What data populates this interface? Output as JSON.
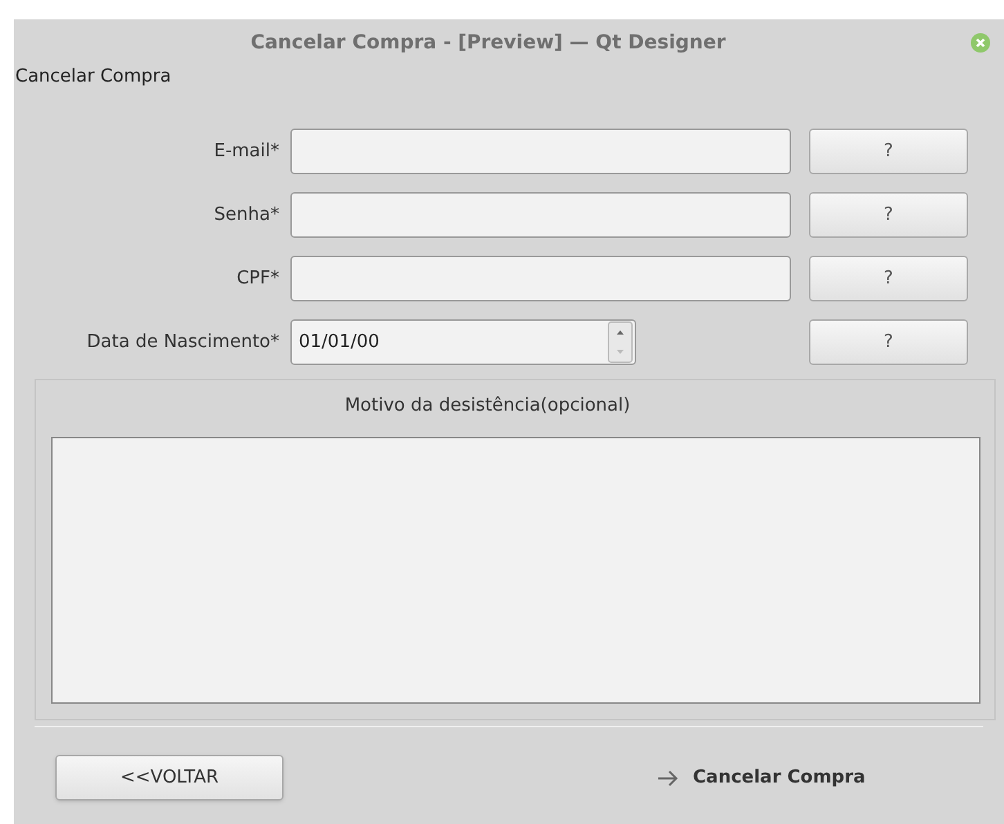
{
  "window": {
    "title": "Cancelar Compra - [Preview] — Qt Designer"
  },
  "form_title": "Cancelar Compra",
  "fields": [
    {
      "kind": "text",
      "label": "E-mail*",
      "help": "?"
    },
    {
      "kind": "text",
      "label": "Senha*",
      "help": "?"
    },
    {
      "kind": "text",
      "label": "CPF*",
      "help": "?"
    },
    {
      "kind": "date",
      "label": "Data de Nascimento*",
      "value": "01/01/00",
      "help": "?"
    }
  ],
  "reason_group": {
    "title": "Motivo da desistência(opcional)"
  },
  "buttons": {
    "back": "<<VOLTAR",
    "cancel": "Cancelar Compra"
  }
}
